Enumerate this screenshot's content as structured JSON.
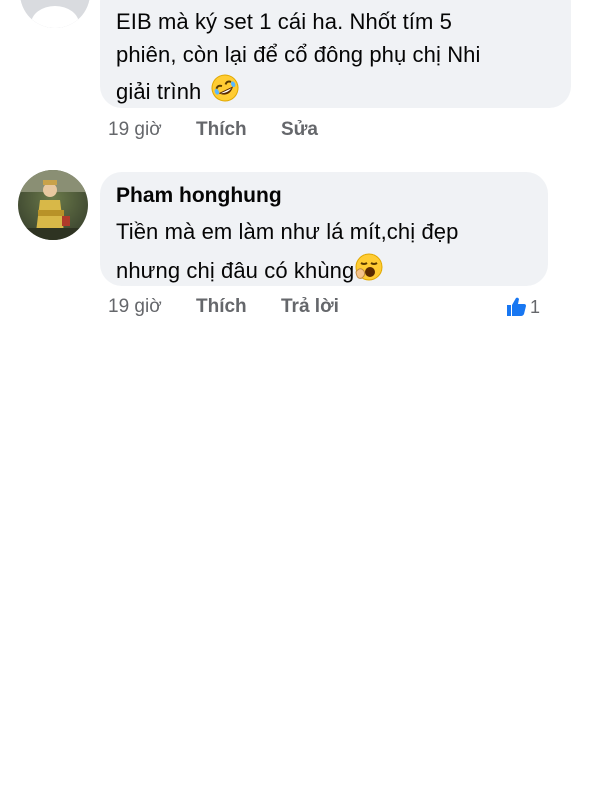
{
  "comments": [
    {
      "author": "",
      "lines": [
        "EIB mà ký set 1 cái ha. Nhốt tím 5",
        "phiên, còn lại để cổ đông phụ chị Nhi",
        "giải trình"
      ],
      "emoji": "rolling-on-floor-laughing",
      "time": "19 giờ",
      "actions": [
        "Thích",
        "Sửa"
      ]
    },
    {
      "author": "Pham honghung",
      "lines": [
        "Tiền mà em làm như lá mít,chị đẹp",
        "nhưng chị đâu có khùng"
      ],
      "emoji": "yawning-face",
      "time": "19 giờ",
      "actions": [
        "Thích",
        "Trả lời"
      ],
      "reaction": {
        "icon": "thumbs-up-icon",
        "count": "1",
        "color": "#1877f2"
      }
    }
  ]
}
